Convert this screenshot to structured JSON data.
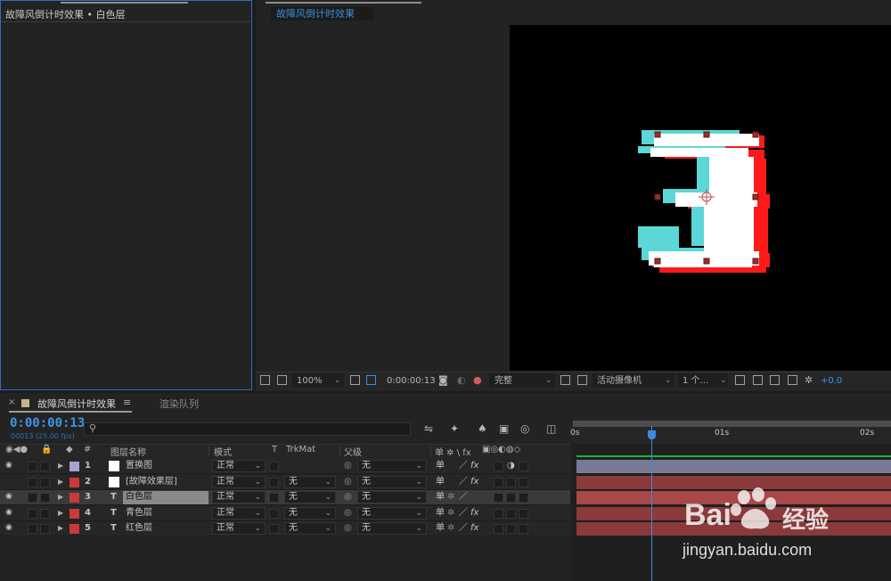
{
  "effect_controls": {
    "title": "故障风倒计时效果 • 白色层"
  },
  "composition": {
    "tab_label": "故障风倒计时效果",
    "toolbar": {
      "zoom": "100%",
      "timecode": "0:00:00:13",
      "resolution": "完整",
      "camera": "活动摄像机",
      "views": "1 个...",
      "exposure": "+0.0"
    },
    "preview_glyph": "3"
  },
  "timeline": {
    "tab_label": "故障风倒计时效果",
    "tab_menu": "≡",
    "render_queue_label": "渲染队列",
    "timecode": "0:00:00:13",
    "timecode_sub": "00013 (25.00 fps)",
    "columns": {
      "num": "#",
      "layer_name": "图层名称",
      "mode": "模式",
      "t": "T",
      "trkmat": "TrkMat",
      "parent": "父级",
      "switches": "单 ✲ \\ fx"
    },
    "ruler": {
      "start": "0s",
      "mark1": "01s",
      "mark2": "02s"
    },
    "layers": [
      {
        "num": "1",
        "name": "置换图",
        "type": "solid",
        "mode": "正常",
        "trkmat": "",
        "parent": "无",
        "label_color": "#a4a4d4",
        "selected": false,
        "bar_color": "#7a7a96"
      },
      {
        "num": "2",
        "name": "[故障效果层]",
        "type": "solid",
        "mode": "正常",
        "trkmat": "无",
        "parent": "无",
        "label_color": "#c83a3a",
        "selected": false,
        "bar_color": "#8a3a3a"
      },
      {
        "num": "3",
        "name": "白色层",
        "type": "text",
        "mode": "正常",
        "trkmat": "无",
        "parent": "无",
        "label_color": "#c83a3a",
        "selected": true,
        "bar_color": "#a84848"
      },
      {
        "num": "4",
        "name": "青色层",
        "type": "text",
        "mode": "正常",
        "trkmat": "无",
        "parent": "无",
        "label_color": "#c83a3a",
        "selected": false,
        "bar_color": "#8a3a3a"
      },
      {
        "num": "5",
        "name": "红色层",
        "type": "text",
        "mode": "正常",
        "trkmat": "无",
        "parent": "无",
        "label_color": "#c83a3a",
        "selected": false,
        "bar_color": "#8a3a3a"
      }
    ]
  },
  "watermark": {
    "brand": "Bai",
    "brand_suffix": "经验",
    "url": "jingyan.baidu.com"
  },
  "colors": {
    "accent_blue": "#3b96e8",
    "panel_border": "#2d6fb8",
    "cyan_glitch": "#5cd6d6",
    "red_glitch": "#ff1a1a"
  }
}
